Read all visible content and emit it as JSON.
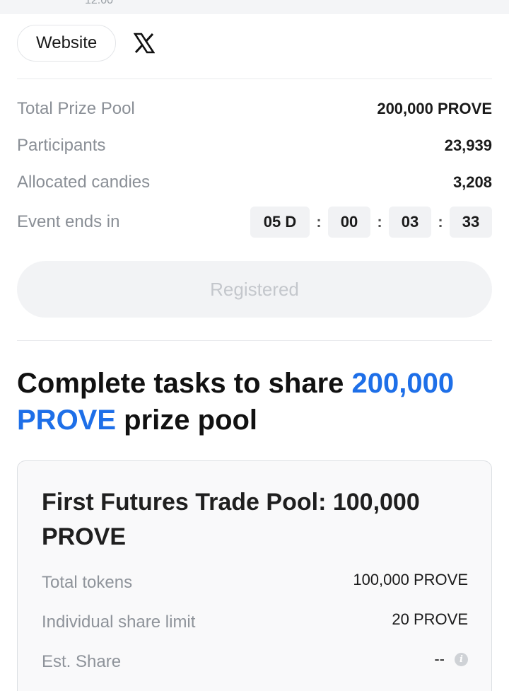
{
  "top": {
    "partial_text": "12:00"
  },
  "links": {
    "website_label": "Website",
    "x_icon": "x-logo-icon"
  },
  "stats": {
    "total_prize_pool": {
      "label": "Total Prize Pool",
      "value": "200,000 PROVE"
    },
    "participants": {
      "label": "Participants",
      "value": "23,939"
    },
    "allocated_candies": {
      "label": "Allocated candies",
      "value": "3,208"
    },
    "event_ends": {
      "label": "Event ends in",
      "days": "05 D",
      "hours": "00",
      "minutes": "03",
      "seconds": "33",
      "separator": ":"
    }
  },
  "register_button": {
    "label": "Registered",
    "state": "disabled"
  },
  "headline": {
    "prefix": "Complete tasks to share ",
    "accent_amount": "200,000",
    "accent_token": "PROVE",
    "suffix": " prize pool",
    "accent_color": "#1e6fe8"
  },
  "pool_card": {
    "title": "First Futures Trade Pool: 100,000 PROVE",
    "rows": [
      {
        "label": "Total tokens",
        "value": "100,000 PROVE"
      },
      {
        "label": "Individual share limit",
        "value": "20 PROVE"
      },
      {
        "label": "Est. Share",
        "value": "--",
        "icon": "info-icon"
      }
    ]
  }
}
